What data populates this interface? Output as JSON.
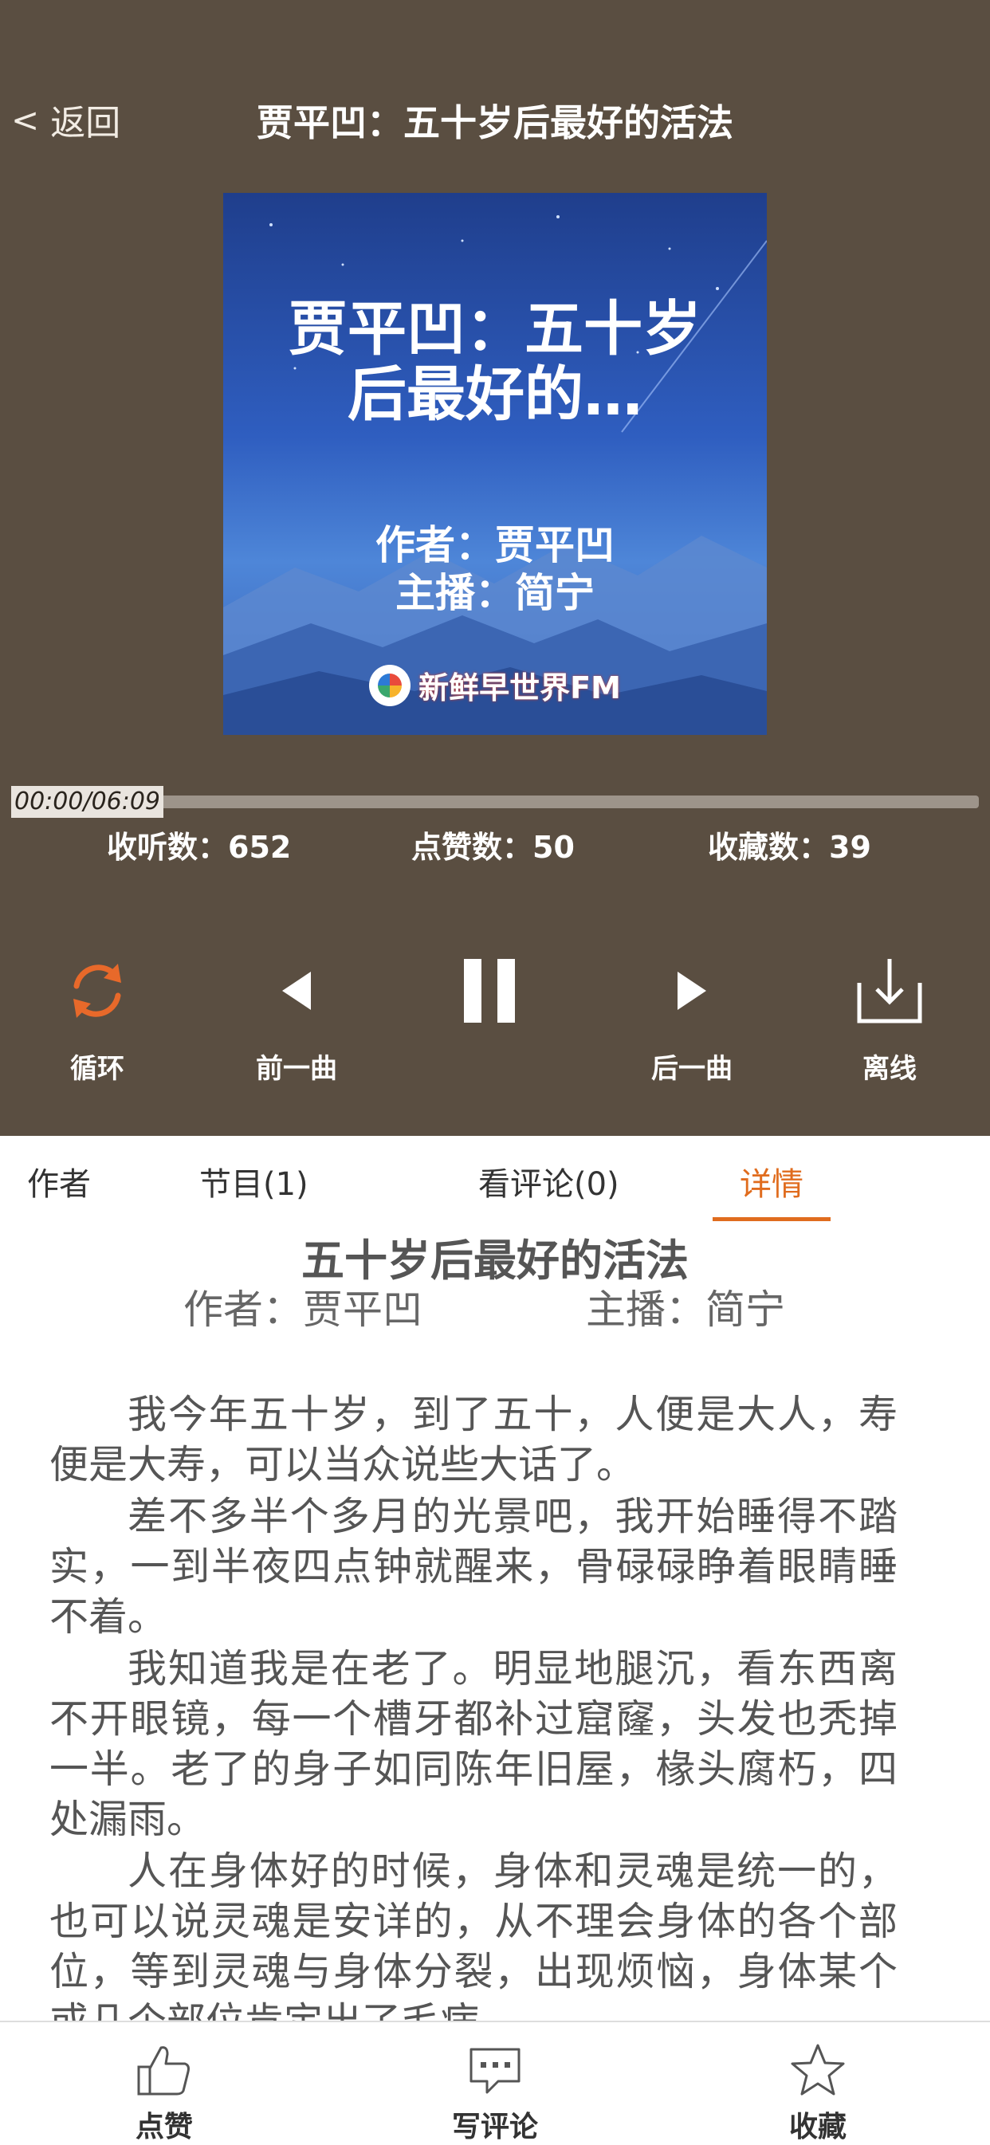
{
  "header": {
    "back_label": "返回",
    "title": "贾平凹：五十岁后最好的活法"
  },
  "cover": {
    "title": "贾平凹：五十岁后最好的…",
    "author_line": "作者：贾平凹",
    "anchor_line": "主播：简宁",
    "logo_text": "新鲜早世界FM"
  },
  "player": {
    "time": "00:00/06:09",
    "progress": 0.0
  },
  "stats": {
    "listens_label": "收听数：",
    "listens": "652",
    "likes_label": "点赞数：",
    "likes": "50",
    "favorites_label": "收藏数：",
    "favorites": "39"
  },
  "controls": {
    "loop": "循环",
    "prev": "前一曲",
    "next": "后一曲",
    "offline": "离线"
  },
  "tabs": [
    "作者",
    "节目(1)",
    "看评论(0)",
    "详情"
  ],
  "active_tab": "详情",
  "detail": {
    "title": "五十岁后最好的活法",
    "author": "作者：贾平凹",
    "anchor": "主播：简宁",
    "paragraphs": [
      "我今年五十岁，到了五十，人便是大人，寿便是大寿，可以当众说些大话了。",
      "差不多半个多月的光景吧，我开始睡得不踏实，一到半夜四点钟就醒来，骨碌碌睁着眼睛睡不着。",
      "我知道我是在老了。明显地腿沉，看东西离不开眼镜，每一个槽牙都补过窟窿，头发也秃掉一半。老了的身子如同陈年旧屋，椽头腐朽，四处漏雨。",
      "人在身体好的时候，身体和灵魂是统一的，也可以说灵魂是安详的，从不理会身体的各个部位，等到灵魂与身体分裂，出现烦恼，身体某个或几个部位肯定出了毛病。"
    ]
  },
  "bottom_bar": {
    "like": "点赞",
    "comment": "写评论",
    "favorite": "收藏"
  },
  "colors": {
    "player_bg": "#5a4e41",
    "accent": "#e06c1e"
  }
}
